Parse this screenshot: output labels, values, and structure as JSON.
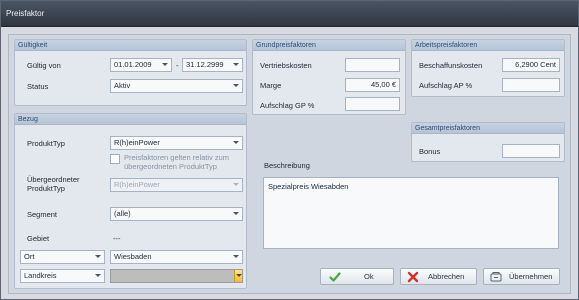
{
  "window": {
    "title": "Preisfaktor"
  },
  "gueltigkeit": {
    "header": "Gültigkeit",
    "gueltig_von_label": "Gültig von",
    "von_value": "01.01.2009",
    "separator": "-",
    "bis_value": "31.12.2999",
    "status_label": "Status",
    "status_value": "Aktiv"
  },
  "grundpreis": {
    "header": "Grundpreisfaktoren",
    "vertriebskosten_label": "Vertriebskosten",
    "vertriebskosten_value": "",
    "marge_label": "Marge",
    "marge_value": "45,00 €",
    "aufschlag_label": "Aufschlag GP %",
    "aufschlag_value": ""
  },
  "arbeitspreis": {
    "header": "Arbeitspreisfaktoren",
    "beschaffungskosten_label": "Beschaffunskosten",
    "beschaffungskosten_value": "6,2900 Cent",
    "aufschlag_label": "Aufschlag AP %",
    "aufschlag_value": ""
  },
  "gesamtpreis": {
    "header": "Gesamtpreisfaktoren",
    "bonus_label": "Bonus",
    "bonus_value": ""
  },
  "bezug": {
    "header": "Bezug",
    "produkttyp_label": "ProduktTyp",
    "produkttyp_value": "R(h)einPower",
    "checkbox_label_line1": "Preisfaktoren gelten relativ zum",
    "checkbox_label_line2": "übergeordneten ProduktTyp",
    "uebergeordneter_label_line1": "Übergeordneter",
    "uebergeordneter_label_line2": "ProduktTyp",
    "uebergeordneter_value": "R(h)einPower",
    "segment_label": "Segment",
    "segment_value": "(alle)",
    "gebiet_label": "Gebiet",
    "gebiet_value": "---",
    "ort_type": "Ort",
    "ort_value": "Wiesbaden",
    "landkreis_type": "Landkreis",
    "landkreis_value": ""
  },
  "beschreibung": {
    "label": "Beschreibung",
    "text": "Spezialpreis Wiesabden"
  },
  "buttons": {
    "ok": "Ok",
    "abbrechen": "Abbrechen",
    "uebernehmen": "Übernehmen"
  },
  "colors": {
    "accent": "#2f4c73",
    "ok_green": "#49a83a",
    "cancel_red": "#d2322d"
  }
}
